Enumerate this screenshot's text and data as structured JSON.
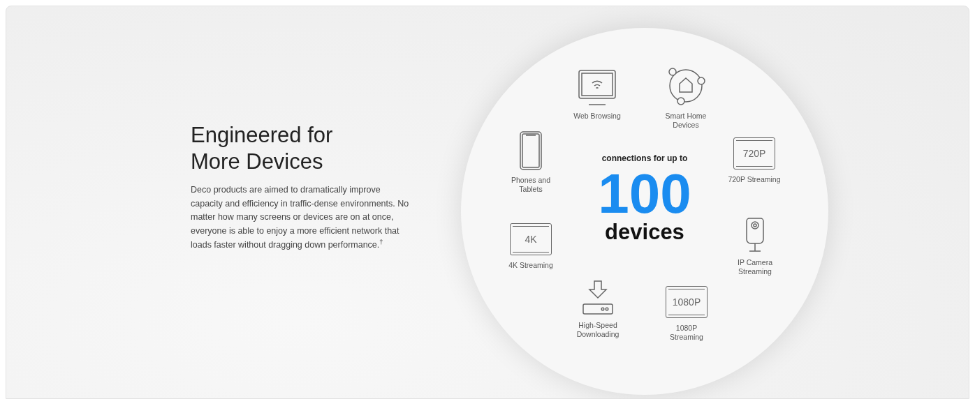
{
  "heading": {
    "lines": [
      "Engineered for",
      "More Devices"
    ]
  },
  "body": "Deco products are aimed to dramatically improve capacity and efficiency in traffic-dense environments. No matter how many screens or devices are on at once, everyone is able to enjoy a more efficient network that loads faster without dragging down performance.$^{†}$",
  "center": {
    "caption": "connections for up to",
    "number": "100",
    "unit": "devices"
  },
  "devices": [
    {
      "kind": "monitor",
      "label": "Web Browsing"
    },
    {
      "kind": "smart-home",
      "label": "Smart Home Devices"
    },
    {
      "kind": "phone",
      "label": "Phones and Tablets"
    },
    {
      "kind": "screen",
      "screen_text": "720P",
      "label": "720P Streaming"
    },
    {
      "kind": "screen",
      "screen_text": "4K",
      "label": "4K Streaming"
    },
    {
      "kind": "camera",
      "label": "IP Camera Streaming"
    },
    {
      "kind": "download",
      "label": "High-Speed Downloading"
    },
    {
      "kind": "screen",
      "screen_text": "1080P",
      "label": "1080P Streaming"
    }
  ]
}
